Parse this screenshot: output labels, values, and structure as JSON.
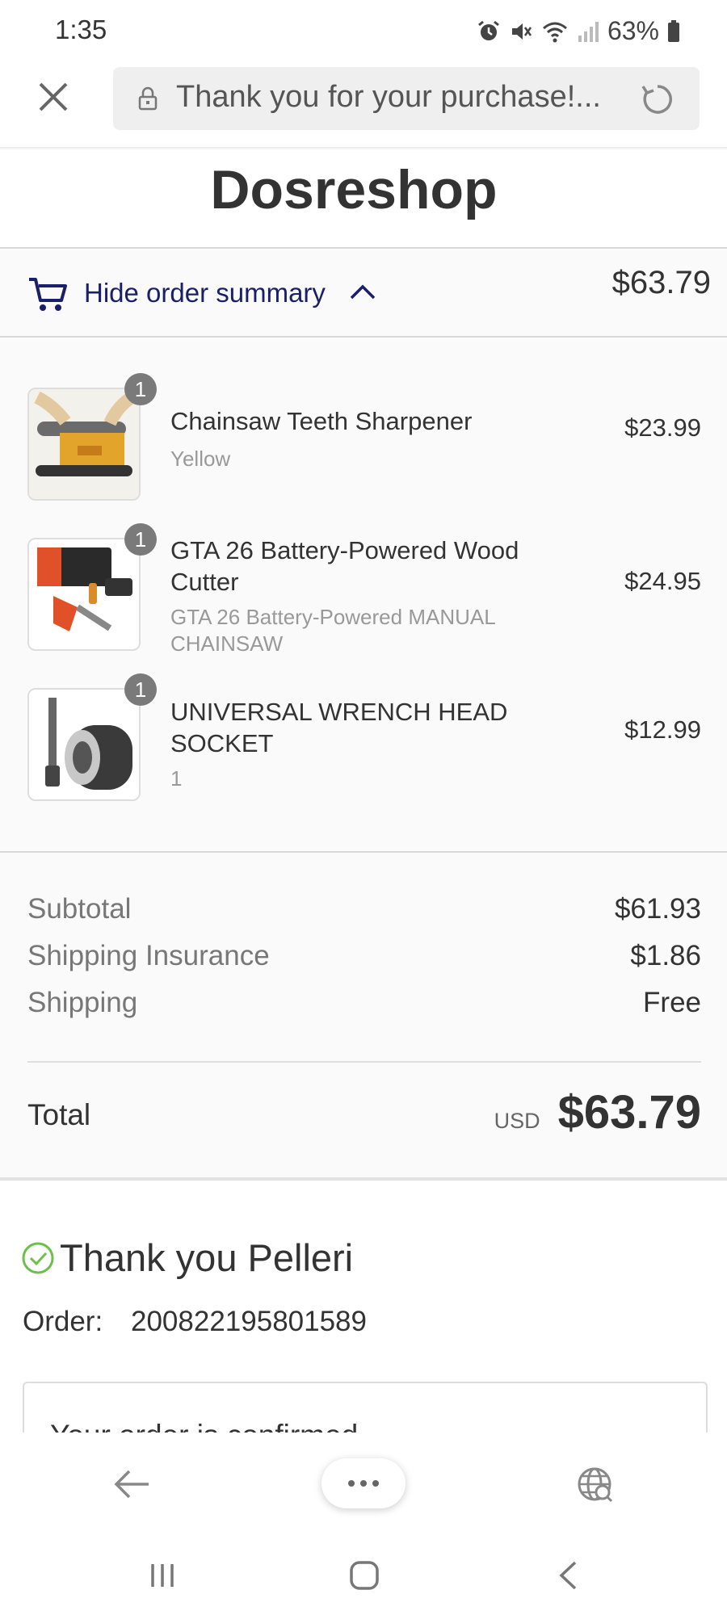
{
  "status_bar": {
    "time": "1:35",
    "battery": "63%"
  },
  "url_bar": {
    "title": "Thank you for your purchase!..."
  },
  "shop": {
    "name": "Dosreshop"
  },
  "summary": {
    "toggle_label": "Hide order summary",
    "total": "$63.79"
  },
  "items": [
    {
      "qty": "1",
      "name": "Chainsaw Teeth Sharpener",
      "variant": "Yellow",
      "price": "$23.99"
    },
    {
      "qty": "1",
      "name": "GTA 26 Battery-Powered Wood Cutter",
      "variant": "GTA 26 Battery-Powered MANUAL CHAINSAW",
      "price": "$24.95"
    },
    {
      "qty": "1",
      "name": "UNIVERSAL WRENCH HEAD SOCKET",
      "variant": "1",
      "price": "$12.99"
    }
  ],
  "totals": {
    "subtotal_label": "Subtotal",
    "subtotal": "$61.93",
    "insurance_label": "Shipping Insurance",
    "insurance": "$1.86",
    "shipping_label": "Shipping",
    "shipping": "Free",
    "total_label": "Total",
    "currency": "USD",
    "total": "$63.79"
  },
  "thank_you": {
    "title": "Thank you Pelleri",
    "order_label": "Order:",
    "order_number": "200822195801589",
    "confirm_text": "Your order is confirmed"
  },
  "colors": {
    "accent": "#1a1f6b",
    "success": "#6cc04a",
    "badge": "#7a7a7a"
  }
}
